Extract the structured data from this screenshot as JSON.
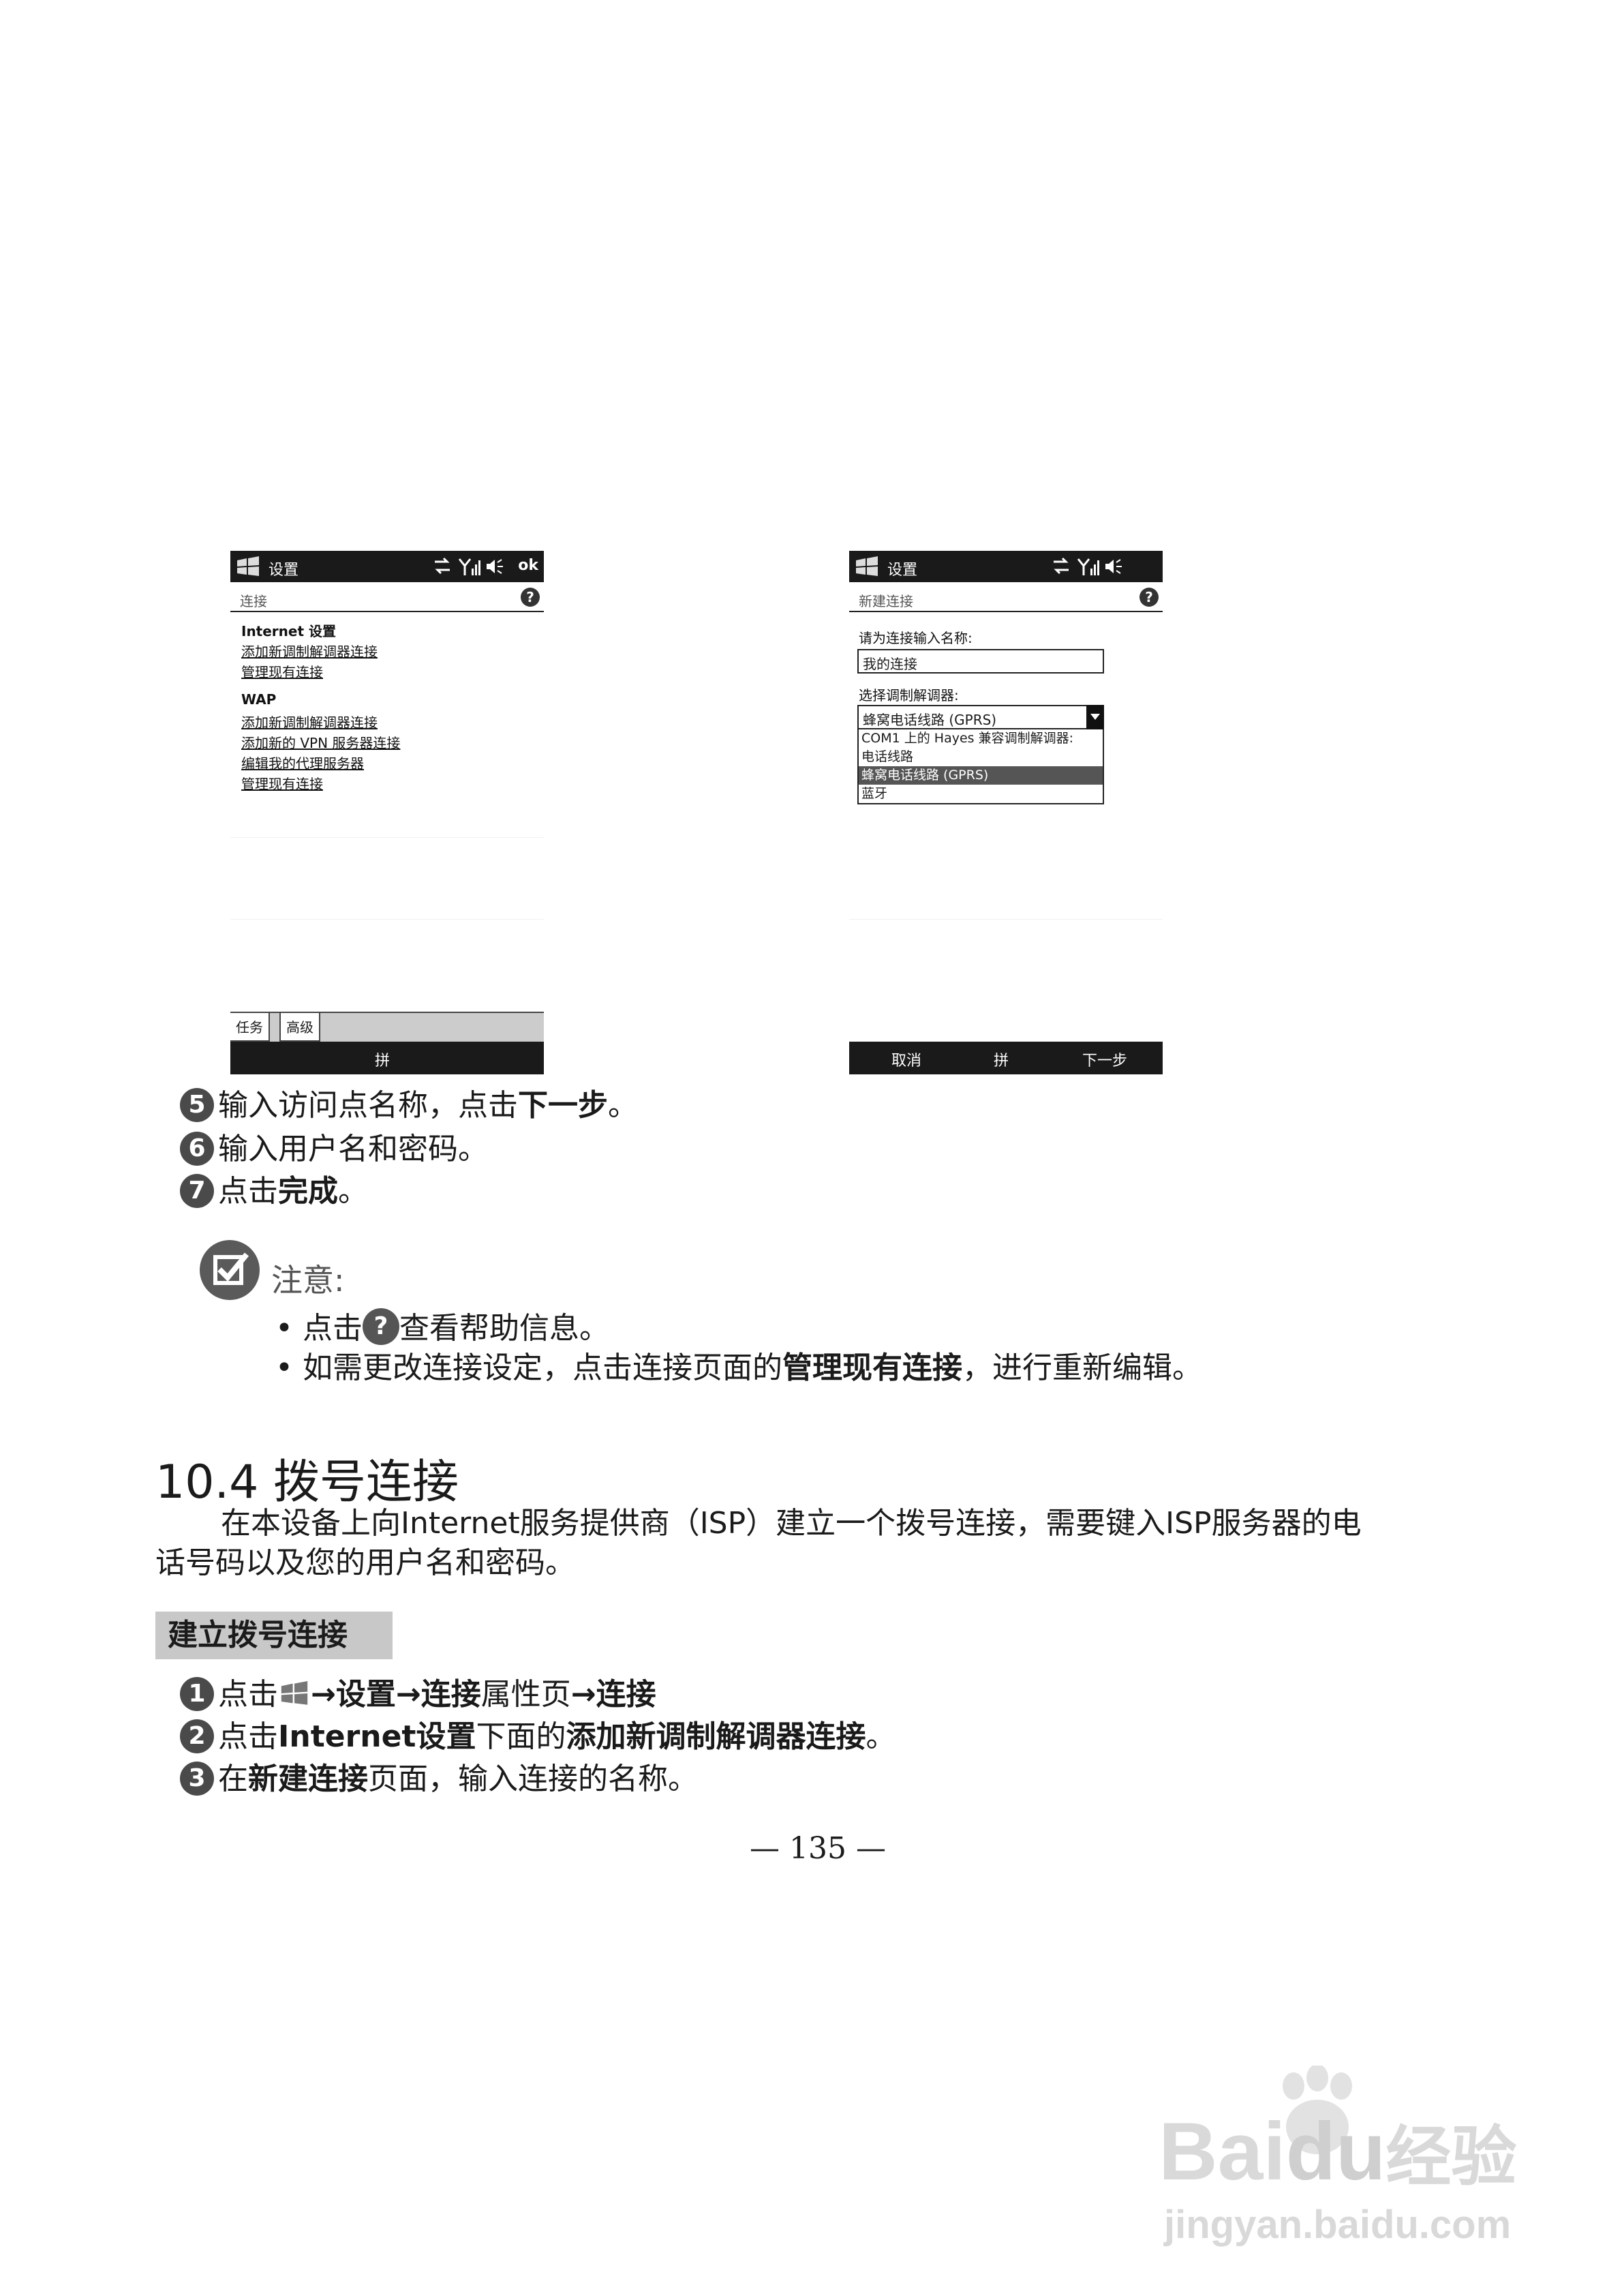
{
  "screen_left": {
    "title": "设置",
    "ok": "ok",
    "header": "连接",
    "internet_head": "Internet 设置",
    "internet_links": [
      "添加新调制解调器连接",
      "管理现有连接"
    ],
    "wap_head": "WAP",
    "wap_links": [
      "添加新调制解调器连接",
      "添加新的 VPN 服务器连接",
      "编辑我的代理服务器",
      "管理现有连接"
    ],
    "tabs": [
      "任务",
      "高级"
    ],
    "menu_center": "拼"
  },
  "screen_right": {
    "title": "设置",
    "header": "新建连接",
    "name_prompt": "请为连接输入名称:",
    "name_value": "我的连接",
    "modem_prompt": "选择调制解调器:",
    "modem_selected": "蜂窝电话线路 (GPRS)",
    "modem_options": [
      "COM1 上的 Hayes 兼容调制解调器:",
      "电话线路",
      "蜂窝电话线路 (GPRS)",
      "蓝牙"
    ],
    "menu": [
      "取消",
      "拼",
      "下一步"
    ]
  },
  "steps_top": [
    {
      "num": "5",
      "pre": "输入访问点名称，点击",
      "bold": "下一步",
      "post": "。"
    },
    {
      "num": "6",
      "pre": "输入用户名和密码。",
      "bold": "",
      "post": ""
    },
    {
      "num": "7",
      "pre": "点击",
      "bold": "完成",
      "post": "。"
    }
  ],
  "note": {
    "title": "注意:",
    "bullet1_pre": "点击",
    "bullet1_post": "查看帮助信息。",
    "bullet2_pre": "如需更改连接设定，点击连接页面的",
    "bullet2_bold": "管理现有连接",
    "bullet2_post": "，进行重新编辑。"
  },
  "section": {
    "heading": "10.4  拨号连接",
    "para_line1": "在本设备上向Internet服务提供商（ISP）建立一个拨号连接，需要键入ISP服务器的电",
    "para_line2": "话号码以及您的用户名和密码。",
    "subhead": "建立拨号连接"
  },
  "steps_bottom": {
    "s1": {
      "num": "1",
      "t1": "点击",
      "arrow": "→",
      "b1": "设置",
      "b2": "连接",
      "t2": "属性页",
      "b3": "连接"
    },
    "s2": {
      "num": "2",
      "t1": "点击",
      "b1": "Internet设置",
      "t2": "下面的",
      "b2": "添加新调制解调器连接",
      "t3": "。"
    },
    "s3": {
      "num": "3",
      "t1": "在",
      "b1": "新建连接",
      "t2": "页面，输入连接的名称。"
    }
  },
  "page_number": "— 135 —",
  "watermark": {
    "brand": "Bai",
    "brand2": "du",
    "brand3": "经验",
    "url": "jingyan.baidu.com"
  }
}
